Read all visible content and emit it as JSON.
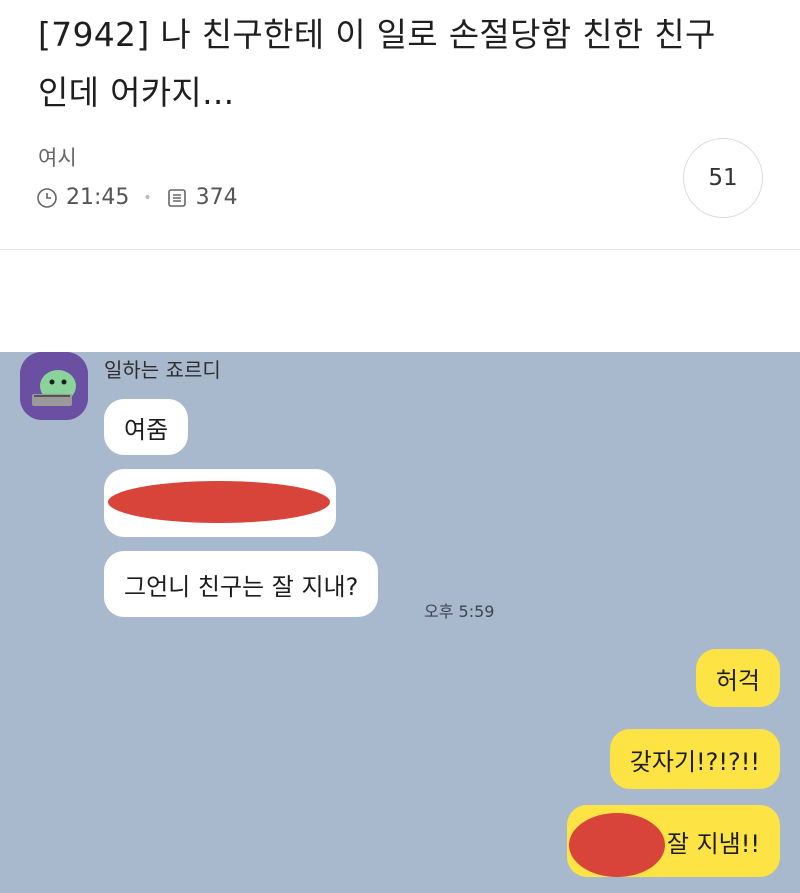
{
  "post": {
    "title": "[7942] 나 친구한테 이 일로 손절당함 친한 친구인데 어카지...",
    "author": "여시",
    "time": "21:45",
    "views": "374",
    "comment_count": "51"
  },
  "chat": {
    "sender_name": "일하는 죠르디",
    "messages_left": [
      "여줌",
      "그언니 친구는 잘 지내?"
    ],
    "timestamp": "오후 5:59",
    "messages_right": [
      "허걱",
      "갖자기!?!?!!",
      "잘 지냄!!"
    ],
    "colors": {
      "background": "#a9b9cd",
      "my_bubble": "#fde444",
      "their_bubble": "#ffffff",
      "redaction": "#d9443a"
    }
  }
}
